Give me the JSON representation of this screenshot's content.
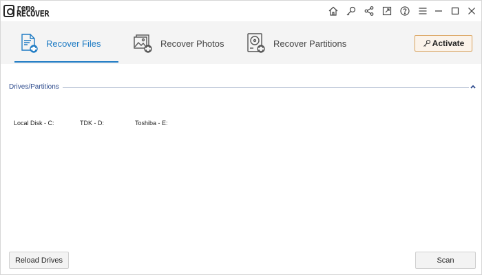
{
  "app": {
    "logo_line1": "remo",
    "logo_line2": "RECOVER"
  },
  "titlebar": {
    "icons": [
      "home-icon",
      "search-key-icon",
      "share-icon",
      "feedback-icon",
      "help-icon",
      "menu-icon"
    ],
    "window_controls": [
      "minimize-icon",
      "maximize-icon",
      "close-icon"
    ]
  },
  "tabs": [
    {
      "label": "Recover Files",
      "icon": "recover-files-icon",
      "active": true
    },
    {
      "label": "Recover Photos",
      "icon": "recover-photos-icon",
      "active": false
    },
    {
      "label": "Recover Partitions",
      "icon": "recover-partitions-icon",
      "active": false
    }
  ],
  "activate": {
    "label": "Activate",
    "icon": "key-icon"
  },
  "drives_section": {
    "title": "Drives/Partitions",
    "drives": [
      {
        "label": "Local Disk - C:"
      },
      {
        "label": "TDK - D:"
      },
      {
        "label": "Toshiba - E:"
      }
    ]
  },
  "buttons": {
    "reload": "Reload Drives",
    "scan": "Scan"
  },
  "colors": {
    "accent": "#1e7bc4",
    "section_title": "#2c4a8c",
    "activate_border": "#d9a15a",
    "tabstrip_bg": "#f4f4f4"
  }
}
